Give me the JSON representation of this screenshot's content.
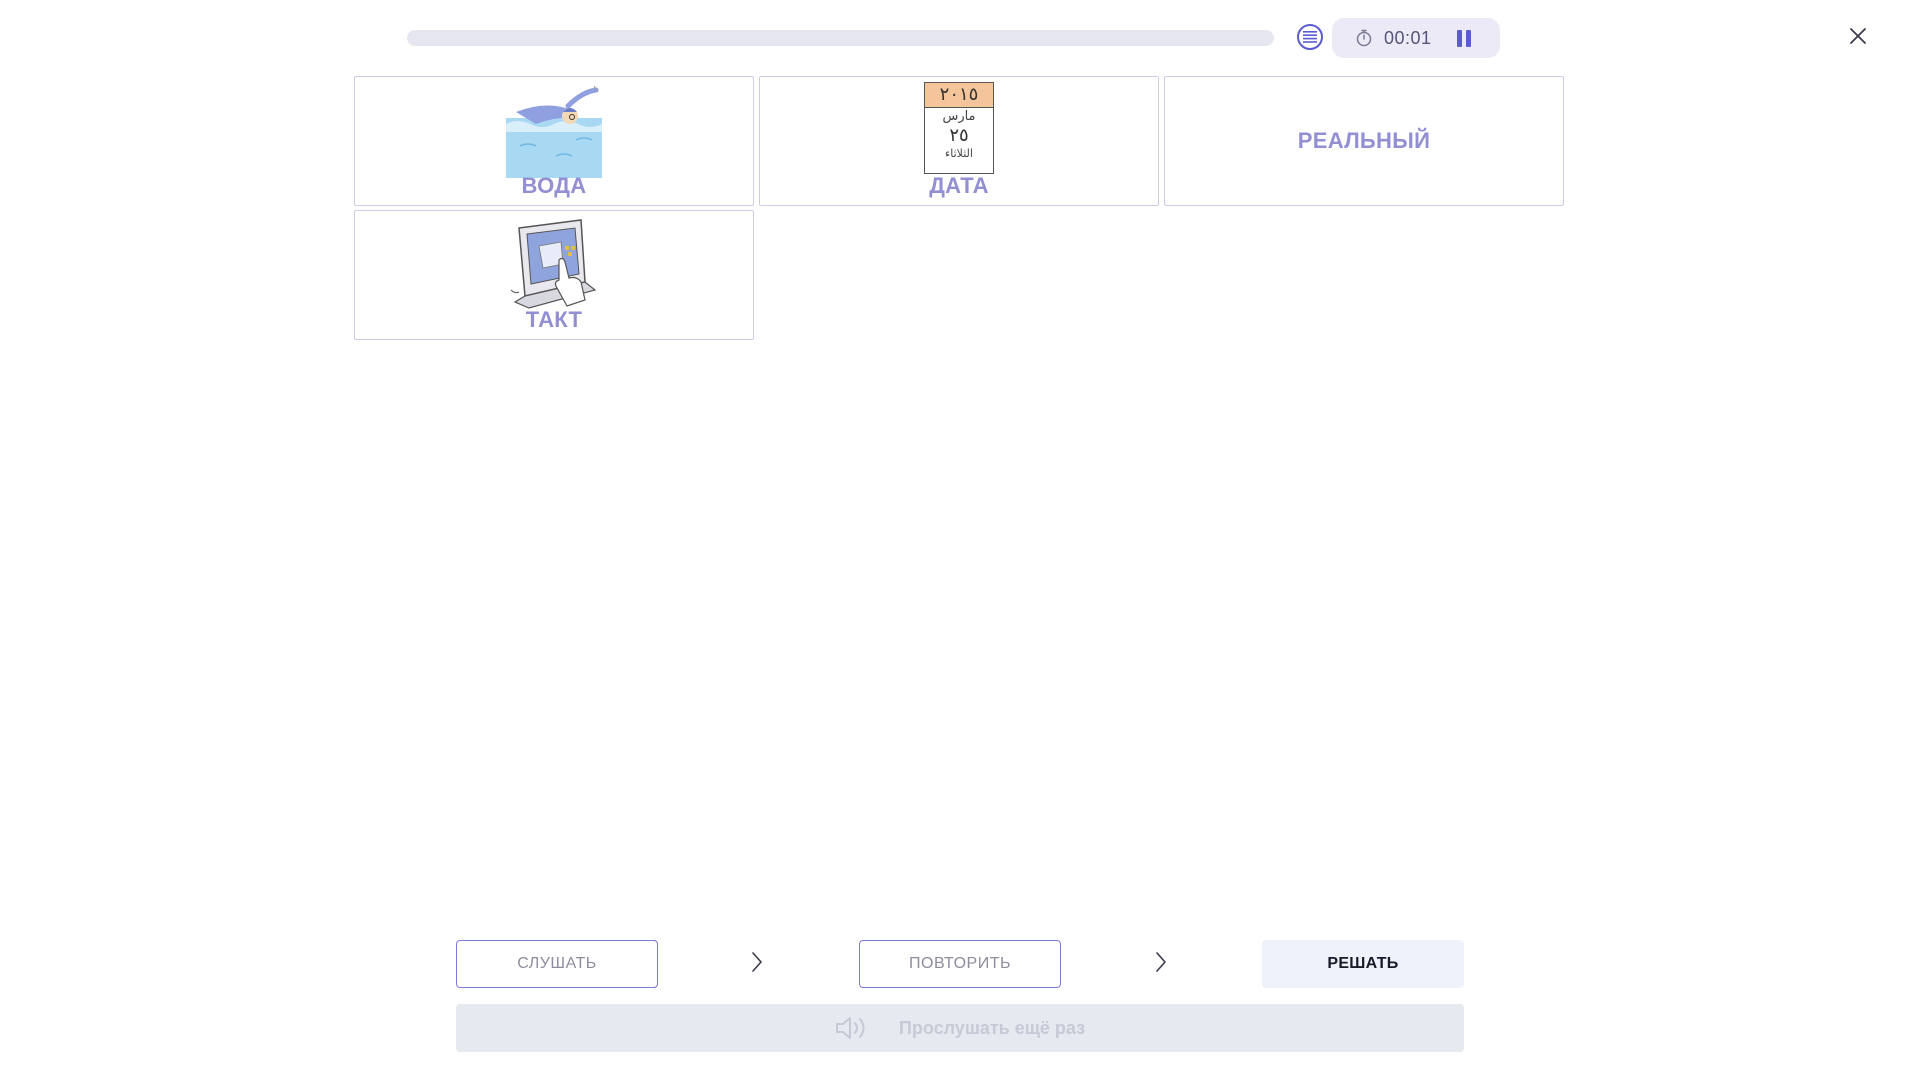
{
  "header": {
    "progress_percent": 0,
    "timer": "00:01",
    "list_icon": "list-icon",
    "timer_icon": "stopwatch-icon",
    "pause_icon": "pause-icon",
    "close_icon": "close-icon"
  },
  "cards": [
    {
      "label": "ВОДА",
      "image": "swimmer-picture"
    },
    {
      "label": "ДАТА",
      "image": "calendar-date-picture",
      "calendar": {
        "year": "٢٠١٥",
        "month": "مارس",
        "day": "٢٥",
        "weekday": "الثلاثاء"
      }
    },
    {
      "label": "РЕАЛЬНЫЙ"
    },
    {
      "label": "ТАКТ",
      "image": "touchscreen-picture"
    }
  ],
  "controls": {
    "listen_label": "СЛУШАТЬ",
    "repeat_label": "ПОВТОРИТЬ",
    "solve_label": "РЕШАТЬ",
    "replay_label": "Прослушать ещё раз",
    "replay_icon": "speaker-icon",
    "arrow_icon": "chevron-right-icon"
  },
  "colors": {
    "accent": "#5b5bd2",
    "card_label": "#928fd2",
    "card_border": "#cfcde6"
  }
}
